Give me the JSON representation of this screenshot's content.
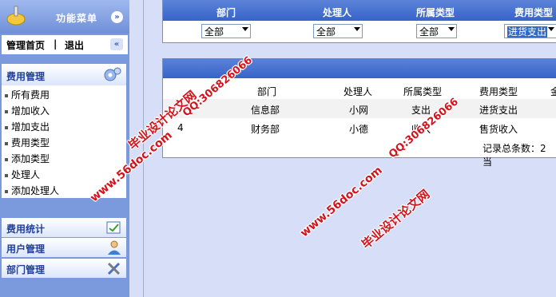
{
  "sidebar": {
    "menu_title": "功能菜单",
    "collapse_symbol": "»",
    "home_link": "管理首页",
    "separator": "|",
    "logout_link": "退出",
    "back_symbol": "«",
    "expense_section": {
      "title": "费用管理",
      "items": [
        "所有费用",
        "增加收入",
        "增加支出",
        "费用类型",
        "添加类型",
        "处理人",
        "添加处理人"
      ]
    },
    "stats_section": "费用统计",
    "user_section": "用户管理",
    "dept_section": "部门管理"
  },
  "filter": {
    "headers": [
      "部门",
      "处理人",
      "所属类型",
      "费用类型"
    ],
    "dept_value": "全部",
    "handler_value": "全部",
    "type_value": "全部",
    "cost_type_value": "进货支出"
  },
  "results": {
    "headers": [
      "部门",
      "处理人",
      "所属类型",
      "费用类型",
      "金"
    ],
    "rows": [
      {
        "id": "",
        "dept": "信息部",
        "handler": "小网",
        "type": "支出",
        "cost_type": "进货支出"
      },
      {
        "id": "4",
        "dept": "财务部",
        "handler": "小德",
        "type": "收入",
        "cost_type": "售货收入"
      }
    ],
    "footer": "记录总条数：2 当"
  },
  "watermarks": {
    "site": "www.56doc.com",
    "qq": "QQ:306826066",
    "name": "毕业设计论文网"
  },
  "colors": {
    "sidebar_bg": "#7b9ade",
    "header_blue": "#3764c9",
    "section_title": "#1f3f99",
    "watermark": "#d2141c",
    "page_bg": "#d6dff7"
  }
}
